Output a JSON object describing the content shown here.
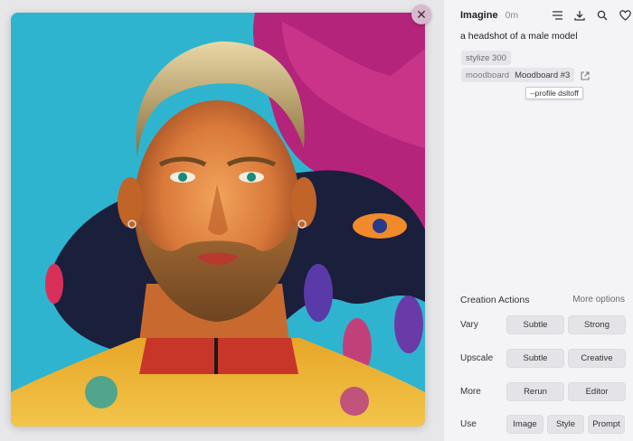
{
  "image": {
    "description_icon": "portrait-image"
  },
  "close_label": "✕",
  "header": {
    "title": "Imagine",
    "time": "0m",
    "icons": [
      "menu-lines-icon",
      "download-icon",
      "search-icon",
      "heart-icon"
    ]
  },
  "prompt": "a headshot of a male model",
  "params": {
    "stylize": "stylize 300",
    "moodboard_key": "moodboard",
    "moodboard_value": "Moodboard #3",
    "tooltip": "--profile dsltoff"
  },
  "actions": {
    "title": "Creation Actions",
    "more_options": "More options",
    "rows": [
      {
        "label": "Vary",
        "buttons": [
          "Subtle",
          "Strong"
        ]
      },
      {
        "label": "Upscale",
        "buttons": [
          "Subtle",
          "Creative"
        ]
      },
      {
        "label": "More",
        "buttons": [
          "Rerun",
          "Editor"
        ]
      },
      {
        "label": "Use",
        "buttons": [
          "Image",
          "Style",
          "Prompt"
        ]
      }
    ]
  },
  "colors": {
    "accent_bg": "#f4f4f6",
    "button_bg": "#e4e4e8",
    "image_bg": "#2fb4cf"
  }
}
